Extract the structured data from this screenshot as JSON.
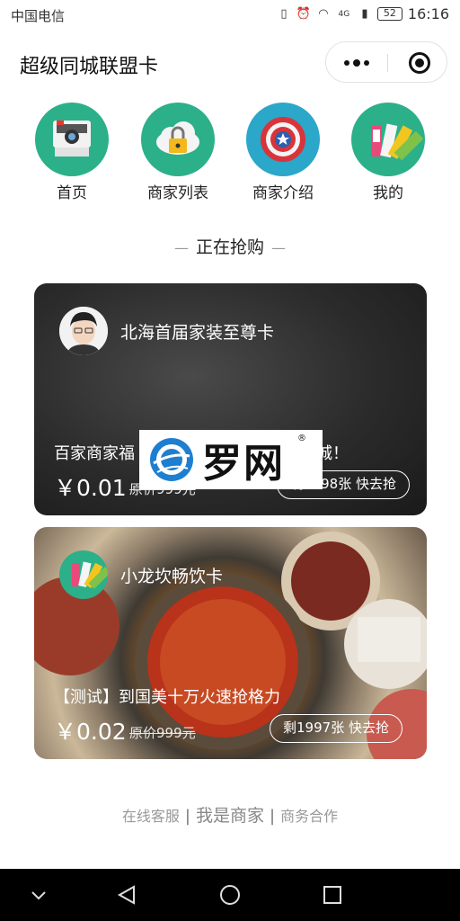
{
  "status_bar": {
    "carrier": "中国电信",
    "network": "4G",
    "battery": "52",
    "time": "16:16"
  },
  "header": {
    "title": "超级同城联盟卡"
  },
  "nav": {
    "items": [
      {
        "label": "首页",
        "icon": "camera-icon",
        "color": "#2bb08a"
      },
      {
        "label": "商家列表",
        "icon": "cloud-lock-icon",
        "color": "#2bb08a"
      },
      {
        "label": "商家介绍",
        "icon": "shield-star-icon",
        "color": "#2aa7c9"
      },
      {
        "label": "我的",
        "icon": "color-palette-icon",
        "color": "#2bb08a"
      }
    ]
  },
  "section": {
    "title": "正在抢购"
  },
  "cards": [
    {
      "name": "北海首届家装至尊卡",
      "promo": "百家商家福",
      "promo_tail": "城！",
      "price": "￥0.01",
      "original_price": "原价999元",
      "button": "剩1998张 快去抢"
    },
    {
      "name": "小龙坎畅饮卡",
      "promo": "【测试】到国美十万火速抢格力",
      "price": "￥0.02",
      "original_price": "原价999元",
      "button": "剩1997张 快去抢"
    }
  ],
  "watermark": {
    "text": "罗网",
    "registered": "®"
  },
  "footer": {
    "links": [
      "在线客服",
      "我是商家",
      "商务合作"
    ]
  },
  "system_nav": {
    "buttons": [
      "collapse-icon",
      "back-icon",
      "home-icon",
      "recents-icon"
    ]
  },
  "colors": {
    "accent_green": "#2bb08a",
    "accent_blue": "#2aa7c9",
    "card_dark": "#2b2b2b"
  }
}
